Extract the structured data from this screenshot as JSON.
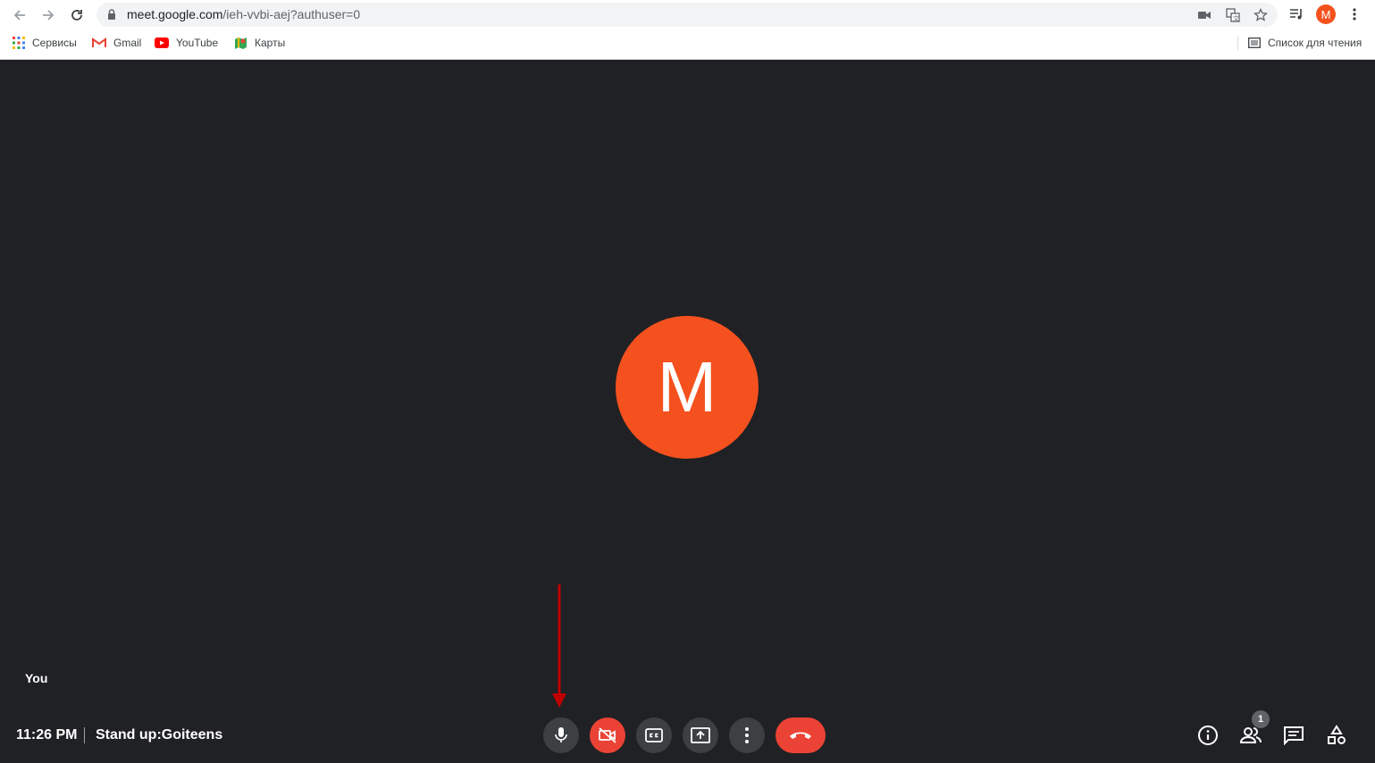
{
  "browser": {
    "url_host": "meet.google.com",
    "url_path": "/ieh-vvbi-aej?authuser=0",
    "profile_initial": "M",
    "bookmarks": [
      {
        "label": "Сервисы",
        "icon": "apps-grid-icon"
      },
      {
        "label": "Gmail",
        "icon": "gmail-icon"
      },
      {
        "label": "YouTube",
        "icon": "youtube-icon"
      },
      {
        "label": "Карты",
        "icon": "maps-icon"
      }
    ],
    "reading_list_label": "Список для чтения"
  },
  "meet": {
    "participant_initial": "M",
    "self_label": "You",
    "time": "11:26 PM",
    "meeting_name": "Stand up:Goiteens",
    "participant_count": "1",
    "colors": {
      "background": "#202124",
      "avatar": "#f4511e",
      "danger": "#ea4335",
      "control": "#3c4043",
      "annotation_arrow": "#c00000"
    }
  }
}
